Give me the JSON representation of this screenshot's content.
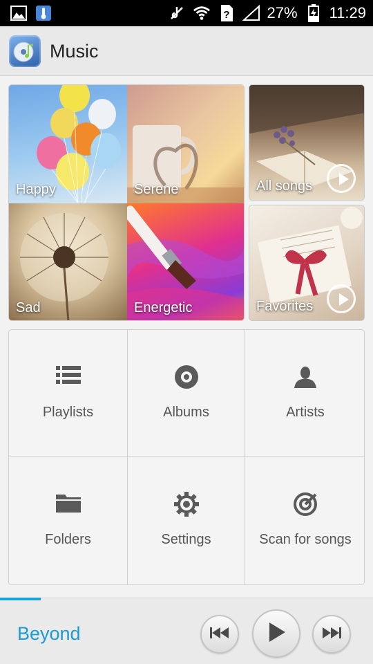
{
  "status_bar": {
    "battery": "27%",
    "time": "11:29",
    "icons": [
      "gallery-icon",
      "thermometer-icon",
      "mute-icon",
      "wifi-icon",
      "sim-unknown-icon",
      "signal-icon",
      "battery-charging-icon"
    ]
  },
  "app_bar": {
    "title": "Music",
    "icon": "music-cd-icon"
  },
  "mood_tiles": [
    {
      "label": "Happy"
    },
    {
      "label": "Serene"
    },
    {
      "label": "Sad"
    },
    {
      "label": "Energetic"
    }
  ],
  "feature_tiles": [
    {
      "label": "All songs",
      "icon": "play-icon"
    },
    {
      "label": "Favorites",
      "icon": "play-icon"
    }
  ],
  "menu": [
    {
      "label": "Playlists",
      "icon": "list-icon"
    },
    {
      "label": "Albums",
      "icon": "disc-icon"
    },
    {
      "label": "Artists",
      "icon": "person-icon"
    },
    {
      "label": "Folders",
      "icon": "folder-icon"
    },
    {
      "label": "Settings",
      "icon": "gear-icon"
    },
    {
      "label": "Scan for songs",
      "icon": "target-icon"
    }
  ],
  "player": {
    "song_title": "Beyond",
    "progress": 0.11,
    "controls": [
      "previous-icon",
      "play-icon",
      "next-icon"
    ]
  },
  "colors": {
    "accent": "#1aa3d6",
    "song_title": "#1b9ad3"
  }
}
